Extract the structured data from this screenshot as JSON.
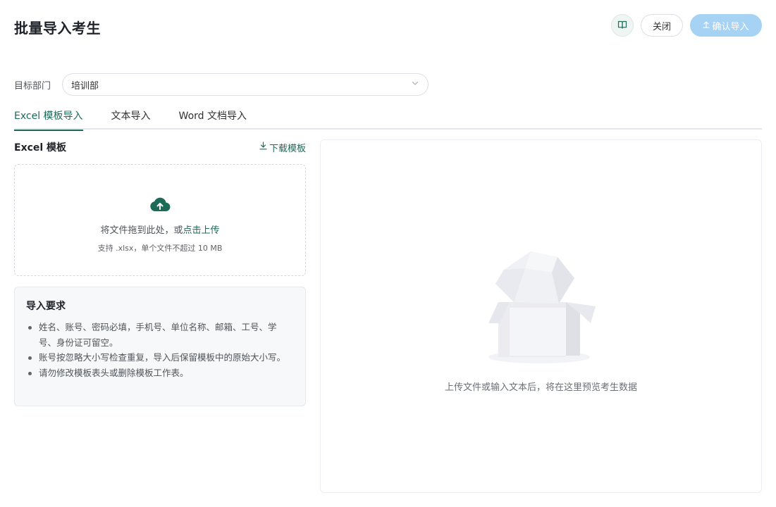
{
  "header": {
    "title": "批量导入考生",
    "guide_icon": "book-open-icon",
    "close_label": "关闭",
    "confirm_icon": "upload-arrow-icon",
    "confirm_label": "确认导入"
  },
  "department": {
    "label": "目标部门",
    "value": "培训部",
    "dropdown_icon": "chevron-down-icon"
  },
  "tabs": [
    {
      "label": "Excel 模板导入",
      "active": true
    },
    {
      "label": "文本导入",
      "active": false
    },
    {
      "label": "Word 文档导入",
      "active": false
    }
  ],
  "excel": {
    "title": "Excel 模板",
    "download_icon": "download-icon",
    "download_label": "下载模板",
    "upload_icon": "cloud-upload-icon",
    "drop_text": "将文件拖到此处，或",
    "drop_link": "点击上传",
    "drop_hint": "支持 .xlsx，单个文件不超过 10 MB"
  },
  "requirements": {
    "title": "导入要求",
    "items": [
      "姓名、账号、密码必填，手机号、单位名称、邮箱、工号、学号、身份证可留空。",
      "账号按忽略大小写检查重复，导入后保留模板中的原始大小写。",
      "请勿修改模板表头或删除模板工作表。"
    ]
  },
  "preview": {
    "empty_icon": "empty-box-icon",
    "empty_text": "上传文件或输入文本后，将在这里预览考生数据"
  },
  "colors": {
    "accent": "#1d6b57",
    "confirm_disabled": "#a6d2f4"
  }
}
